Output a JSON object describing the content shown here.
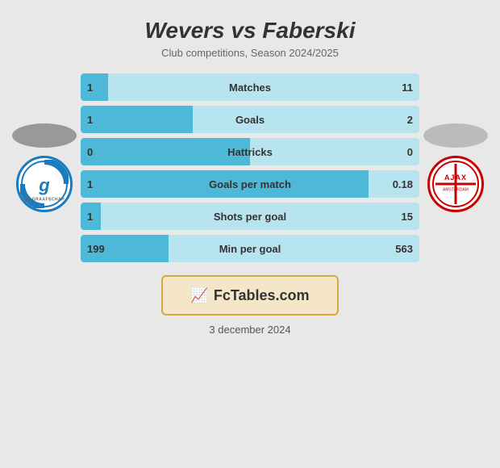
{
  "header": {
    "title": "Wevers vs Faberski",
    "subtitle": "Club competitions, Season 2024/2025"
  },
  "stats": [
    {
      "label": "Matches",
      "left_val": "1",
      "right_val": "11",
      "fill_pct": 8
    },
    {
      "label": "Goals",
      "left_val": "1",
      "right_val": "2",
      "fill_pct": 33
    },
    {
      "label": "Hattricks",
      "left_val": "0",
      "right_val": "0",
      "fill_pct": 50
    },
    {
      "label": "Goals per match",
      "left_val": "1",
      "right_val": "0.18",
      "fill_pct": 85
    },
    {
      "label": "Shots per goal",
      "left_val": "1",
      "right_val": "15",
      "fill_pct": 6
    },
    {
      "label": "Min per goal",
      "left_val": "199",
      "right_val": "563",
      "fill_pct": 26
    }
  ],
  "banner": {
    "icon": "📈",
    "text": "FcTables.com"
  },
  "date": "3 december 2024"
}
